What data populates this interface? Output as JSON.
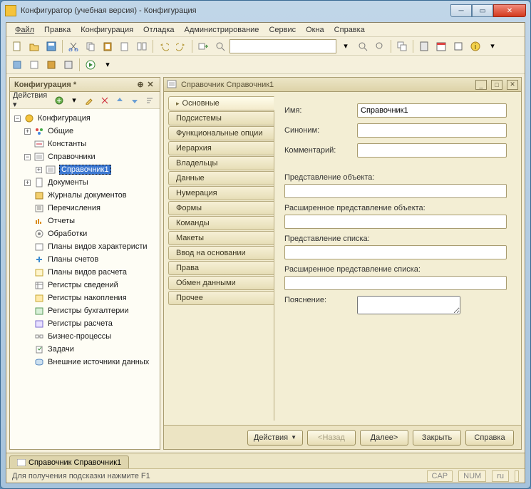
{
  "window": {
    "title": "Конфигуратор (учебная версия) - Конфигурация"
  },
  "menu": {
    "file": "Файл",
    "edit": "Правка",
    "config": "Конфигурация",
    "debug": "Отладка",
    "admin": "Администрирование",
    "service": "Сервис",
    "windows": "Окна",
    "help": "Справка"
  },
  "config_panel": {
    "title": "Конфигурация *",
    "actions": "Действия"
  },
  "tree": {
    "root": "Конфигурация",
    "common": "Общие",
    "const": "Константы",
    "cat": "Справочники",
    "cat1": "Справочник1",
    "doc": "Документы",
    "docjrnl": "Журналы документов",
    "enum": "Перечисления",
    "rep": "Отчеты",
    "proc": "Обработки",
    "pvc": "Планы видов характеристи",
    "acc": "Планы счетов",
    "pvras": "Планы видов расчета",
    "reginfo": "Регистры сведений",
    "regacc": "Регистры накопления",
    "regbuh": "Регистры бухгалтерии",
    "regcalc": "Регистры расчета",
    "bp": "Бизнес-процессы",
    "task": "Задачи",
    "ext": "Внешние источники данных"
  },
  "editor": {
    "title": "Справочник Справочник1",
    "tabs": {
      "main": "Основные",
      "subsys": "Подсистемы",
      "fopt": "Функциональные опции",
      "hier": "Иерархия",
      "own": "Владельцы",
      "data": "Данные",
      "num": "Нумерация",
      "forms": "Формы",
      "cmd": "Команды",
      "tpl": "Макеты",
      "vvod": "Ввод на основании",
      "rights": "Права",
      "exch": "Обмен данными",
      "other": "Прочее"
    },
    "form": {
      "name_l": "Имя:",
      "name_v": "Справочник1",
      "syn_l": "Синоним:",
      "syn_v": "",
      "com_l": "Комментарий:",
      "com_v": "",
      "objrep_l": "Представление объекта:",
      "objrep_v": "",
      "eobjrep_l": "Расширенное представление объекта:",
      "eobjrep_v": "",
      "lstrep_l": "Представление списка:",
      "lstrep_v": "",
      "elstrep_l": "Расширенное представление списка:",
      "elstrep_v": "",
      "expl_l": "Пояснение:",
      "expl_v": ""
    },
    "footer": {
      "actions": "Действия",
      "back": "<Назад",
      "next": "Далее>",
      "close": "Закрыть",
      "help": "Справка"
    }
  },
  "bottom_tab": "Справочник Справочник1",
  "status": {
    "hint": "Для получения подсказки нажмите F1",
    "cap": "CAP",
    "num": "NUM",
    "lang": "ru"
  }
}
